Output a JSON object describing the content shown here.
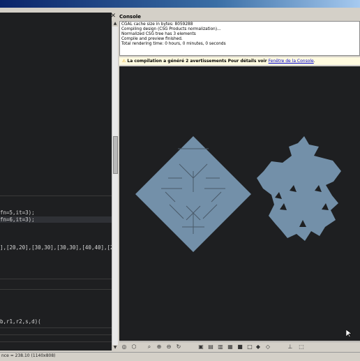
{
  "editor": {
    "lines": [
      {
        "text": "fn=5,it=3);"
      },
      {
        "text": "fn=6,it=3);"
      },
      {
        "text": "],[20,20],[30,30],[30,30],[40,40],[2"
      },
      {
        "text": "b,r1,r2,s,d)("
      }
    ]
  },
  "console": {
    "title": "Console",
    "lines": [
      "CGAL cache size in bytes: 8059288",
      "Compiling design (CSG Products normalization)...",
      "Normalized CSG tree has 3 elements",
      "Compile and preview finished.",
      "Total rendering time: 0 hours, 0 minutes, 0 seconds"
    ]
  },
  "warning": {
    "text": "La compilation a généré 2 avertissements Pour détails voir ",
    "link": "Fenêtre de la Console",
    "end": "."
  },
  "status": {
    "text": "nce = 238.10 (1140x808)"
  },
  "colors": {
    "shape": "#7390a9",
    "viewport": "#1e1f21",
    "line": "#4a5a69"
  },
  "toolbar": {
    "icons": [
      "preview-icon",
      "render-icon",
      "zoom-all-icon",
      "zoom-in-icon",
      "zoom-out-icon",
      "reset-view-icon",
      "view-right-icon",
      "view-top-icon",
      "view-bottom-icon",
      "view-left-icon",
      "view-front-icon",
      "view-back-icon",
      "view-diagonal-icon",
      "view-center-icon",
      "perspective-icon",
      "orthogonal-icon",
      "show-axes-icon",
      "show-edges-icon"
    ]
  }
}
